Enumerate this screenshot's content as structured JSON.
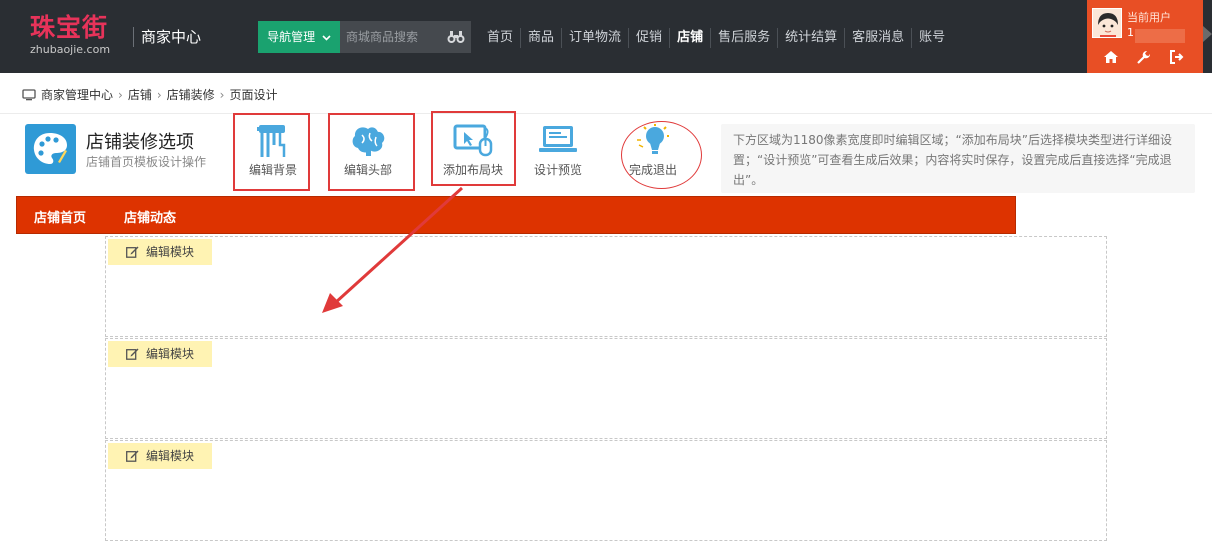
{
  "header": {
    "logo_cn": "珠宝街",
    "logo_url": "zhubaojie.com",
    "center_title": "商家中心",
    "nav_manage_label": "导航管理",
    "search_placeholder": "商城商品搜索",
    "nav_items": [
      "首页",
      "商品",
      "订单物流",
      "促销",
      "店铺",
      "售后服务",
      "统计结算",
      "客服消息",
      "账号"
    ],
    "active_nav": "店铺",
    "user_label": "当前用户",
    "user_name": "1"
  },
  "breadcrumb": [
    "商家管理中心",
    "店铺",
    "店铺装修",
    "页面设计"
  ],
  "toolbox": {
    "title": "店铺装修选项",
    "subtitle": "店铺首页模板设计操作",
    "tools": [
      {
        "label": "编辑背景",
        "icon": "paint-roller-icon"
      },
      {
        "label": "编辑头部",
        "icon": "brain-icon"
      },
      {
        "label": "添加布局块",
        "icon": "monitor-pointer-icon"
      },
      {
        "label": "设计预览",
        "icon": "laptop-icon"
      },
      {
        "label": "完成退出",
        "icon": "lightbulb-icon"
      }
    ],
    "hint": "下方区域为1180像素宽度即时编辑区域；“添加布局块”后选择模块类型进行详细设置；“设计预览”可查看生成后效果；内容将实时保存，设置完成后直接选择“完成退出”。"
  },
  "shop_nav": [
    "店铺首页",
    "店铺动态"
  ],
  "modules": [
    {
      "edit_label": "编辑模块"
    },
    {
      "edit_label": "编辑模块"
    },
    {
      "edit_label": "编辑模块"
    }
  ],
  "colors": {
    "topbar": "#2a2e33",
    "accent_green": "#1aa26f",
    "user_orange": "#e84f25",
    "shop_nav_red": "#dd3300",
    "tool_blue": "#4aa8de",
    "annotation_red": "#e03a3a",
    "edit_yellow": "#fff3b3"
  }
}
